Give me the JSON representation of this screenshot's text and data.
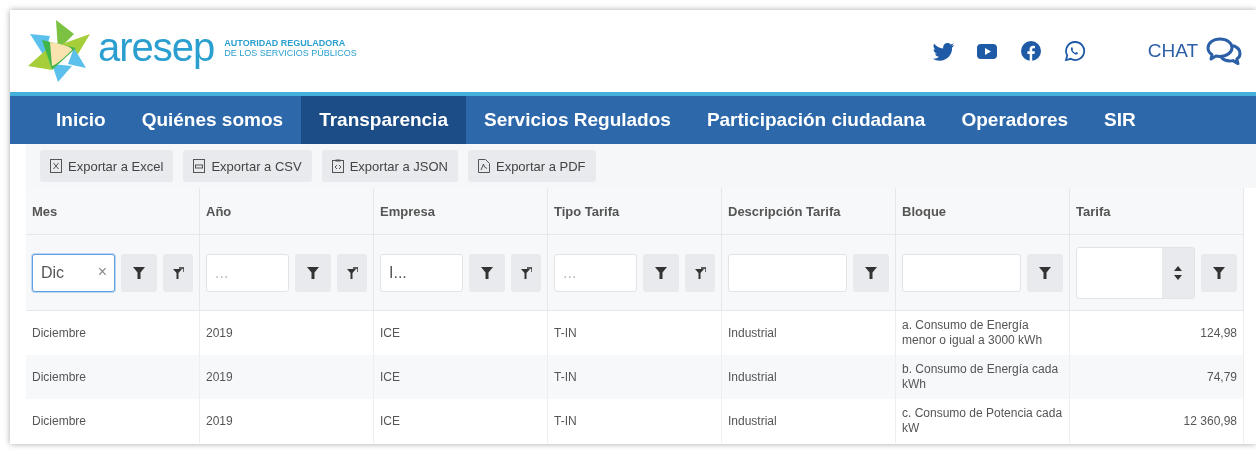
{
  "header": {
    "logo": {
      "name": "aresep",
      "subtitle_1": "AUTORIDAD REGULADORA",
      "subtitle_2": "DE LOS SERVICIOS PÚBLICOS"
    },
    "social": [
      {
        "kind": "twitter"
      },
      {
        "kind": "youtube"
      },
      {
        "kind": "facebook"
      },
      {
        "kind": "whatsapp"
      }
    ],
    "chat": {
      "label": "CHAT"
    }
  },
  "nav": {
    "items": [
      {
        "label": "Inicio",
        "selected": false
      },
      {
        "label": "Quiénes somos",
        "selected": false
      },
      {
        "label": "Transparencia",
        "selected": true
      },
      {
        "label": "Servicios Regulados",
        "selected": false
      },
      {
        "label": "Participación ciudadana",
        "selected": false
      },
      {
        "label": "Operadores",
        "selected": false
      },
      {
        "label": "SIR",
        "selected": false
      }
    ]
  },
  "toolbar": {
    "buttons": [
      {
        "label": "Exportar a Excel",
        "kind": "excel"
      },
      {
        "label": "Exportar a CSV",
        "kind": "csv"
      },
      {
        "label": "Exportar a JSON",
        "kind": "json"
      },
      {
        "label": "Exportar a PDF",
        "kind": "pdf"
      }
    ]
  },
  "table": {
    "columns": [
      {
        "title": "Mes",
        "filter": {
          "kind": "text",
          "value": "Dic",
          "clear_icon": "×",
          "focused": true,
          "reset_button": true
        }
      },
      {
        "title": "Año",
        "filter": {
          "kind": "text",
          "placeholder": "...",
          "focused": false,
          "reset_button": true
        }
      },
      {
        "title": "Empresa",
        "filter": {
          "kind": "text",
          "value": "I...",
          "focused": false,
          "reset_button": true
        }
      },
      {
        "title": "Tipo Tarifa",
        "filter": {
          "kind": "text",
          "placeholder": "...",
          "focused": false,
          "reset_button": true
        }
      },
      {
        "title": "Descripción Tarifa",
        "filter": {
          "kind": "text",
          "focused": false,
          "reset_button": false
        }
      },
      {
        "title": "Bloque",
        "filter": {
          "kind": "text",
          "focused": false,
          "reset_button": false
        }
      },
      {
        "title": "Tarifa",
        "filter": {
          "kind": "number",
          "focused": false,
          "reset_button": false
        }
      }
    ],
    "rows": [
      {
        "cells": [
          "Diciembre",
          "2019",
          "ICE",
          "T-IN",
          "Industrial",
          "a. Consumo de Energía menor o igual a 3000 kWh",
          "124,98"
        ]
      },
      {
        "cells": [
          "Diciembre",
          "2019",
          "ICE",
          "T-IN",
          "Industrial",
          "b. Consumo de Energía cada kWh",
          "74,79"
        ]
      },
      {
        "cells": [
          "Diciembre",
          "2019",
          "ICE",
          "T-IN",
          "Industrial",
          "c. Consumo de Potencia cada kW",
          "12 360,98"
        ]
      }
    ]
  }
}
